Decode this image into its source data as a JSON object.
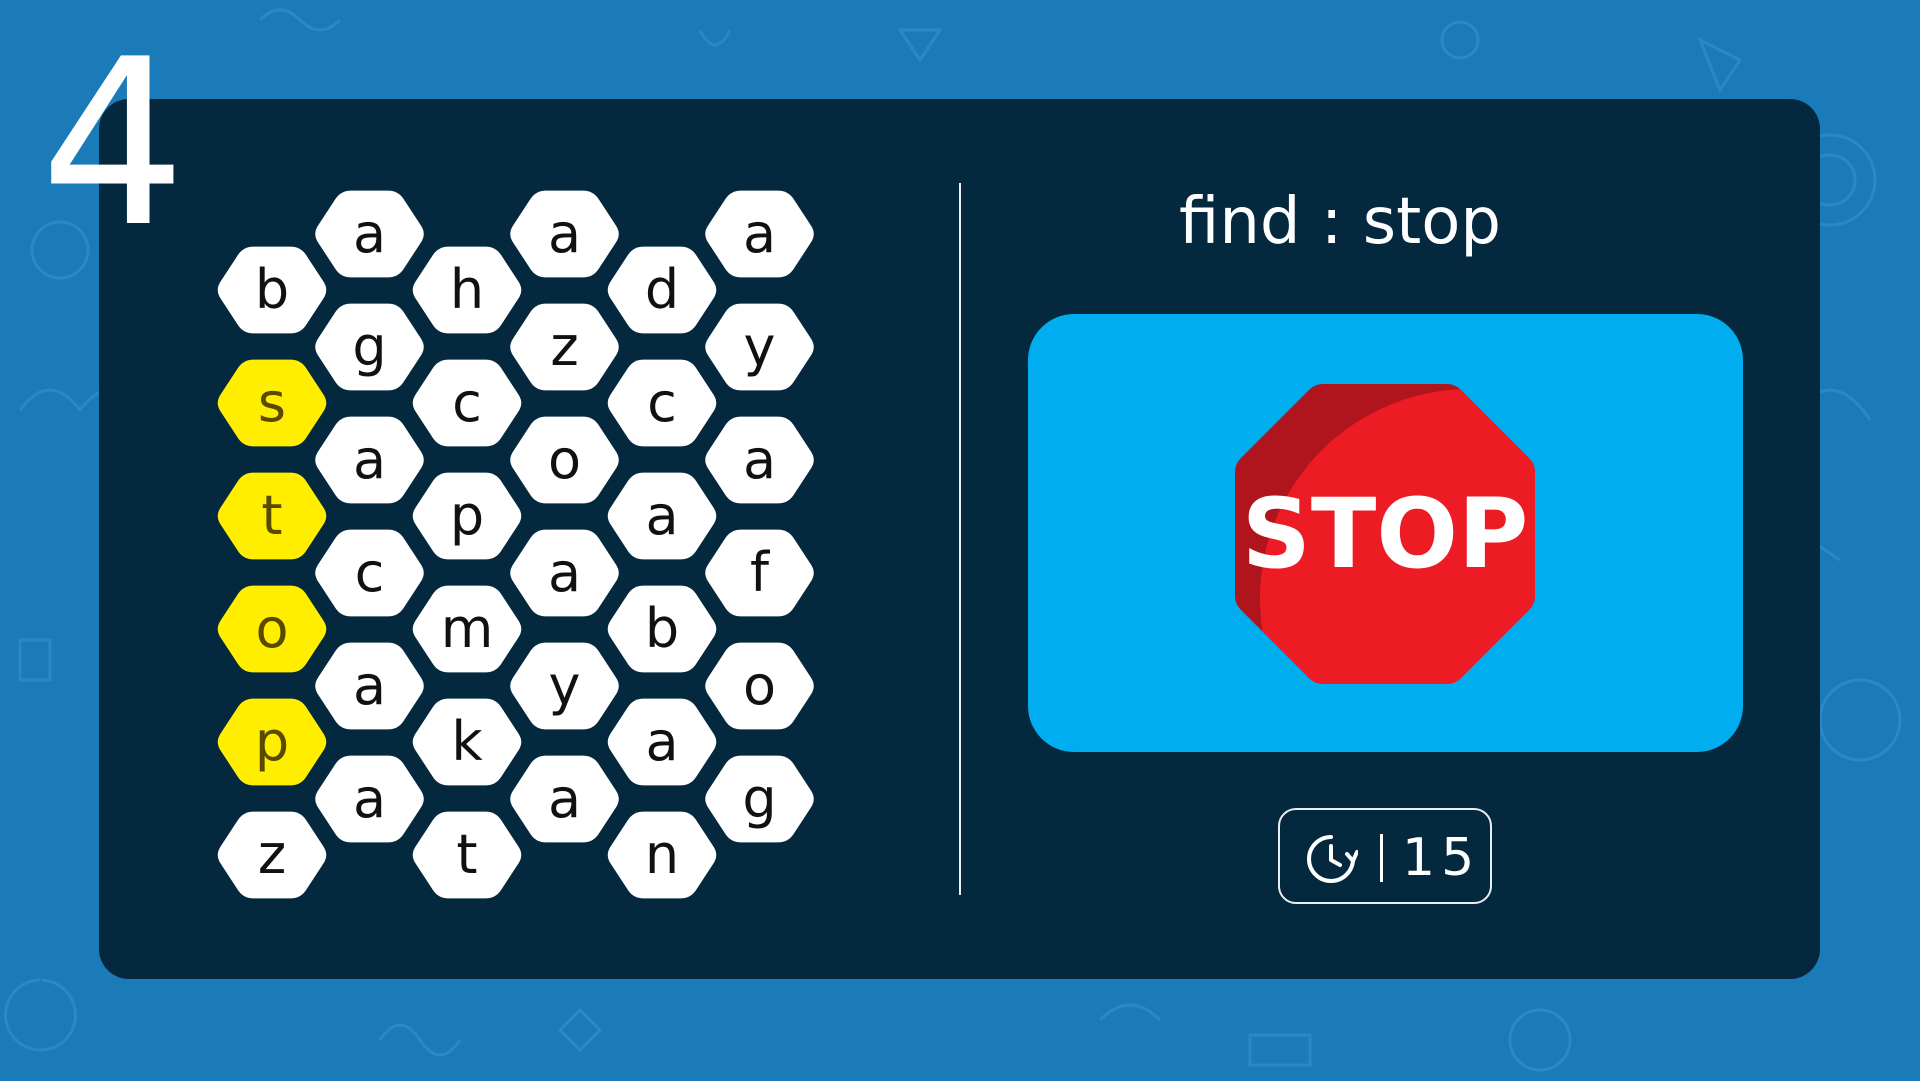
{
  "level": {
    "number": "4"
  },
  "prompt": {
    "label": "find : stop",
    "target_word": "stop"
  },
  "image": {
    "sign_text": "STOP",
    "icon": "stop-sign-icon"
  },
  "timer": {
    "icon": "clock-timer-icon",
    "value": "15"
  },
  "colors": {
    "background": "#1a7bb8",
    "card": "#04283e",
    "hex_default": "#ffffff",
    "hex_highlight": "#ffee00",
    "image_panel": "#00adee",
    "stop_red": "#ed1c24",
    "stop_red_dark": "#b0141c"
  },
  "grid": {
    "columns": [
      {
        "cells": [
          {
            "letter": "b",
            "found": false
          },
          {
            "letter": "s",
            "found": true
          },
          {
            "letter": "t",
            "found": true
          },
          {
            "letter": "o",
            "found": true
          },
          {
            "letter": "p",
            "found": true
          },
          {
            "letter": "z",
            "found": false
          }
        ]
      },
      {
        "cells": [
          {
            "letter": "a",
            "found": false
          },
          {
            "letter": "g",
            "found": false
          },
          {
            "letter": "a",
            "found": false
          },
          {
            "letter": "c",
            "found": false
          },
          {
            "letter": "a",
            "found": false
          },
          {
            "letter": "a",
            "found": false
          }
        ]
      },
      {
        "cells": [
          {
            "letter": "h",
            "found": false
          },
          {
            "letter": "c",
            "found": false
          },
          {
            "letter": "p",
            "found": false
          },
          {
            "letter": "m",
            "found": false
          },
          {
            "letter": "k",
            "found": false
          },
          {
            "letter": "t",
            "found": false
          }
        ]
      },
      {
        "cells": [
          {
            "letter": "a",
            "found": false
          },
          {
            "letter": "z",
            "found": false
          },
          {
            "letter": "o",
            "found": false
          },
          {
            "letter": "a",
            "found": false
          },
          {
            "letter": "y",
            "found": false
          },
          {
            "letter": "a",
            "found": false
          }
        ]
      },
      {
        "cells": [
          {
            "letter": "d",
            "found": false
          },
          {
            "letter": "c",
            "found": false
          },
          {
            "letter": "a",
            "found": false
          },
          {
            "letter": "b",
            "found": false
          },
          {
            "letter": "a",
            "found": false
          },
          {
            "letter": "n",
            "found": false
          }
        ]
      },
      {
        "cells": [
          {
            "letter": "a",
            "found": false
          },
          {
            "letter": "y",
            "found": false
          },
          {
            "letter": "a",
            "found": false
          },
          {
            "letter": "f",
            "found": false
          },
          {
            "letter": "o",
            "found": false
          },
          {
            "letter": "g",
            "found": false
          }
        ]
      }
    ]
  }
}
